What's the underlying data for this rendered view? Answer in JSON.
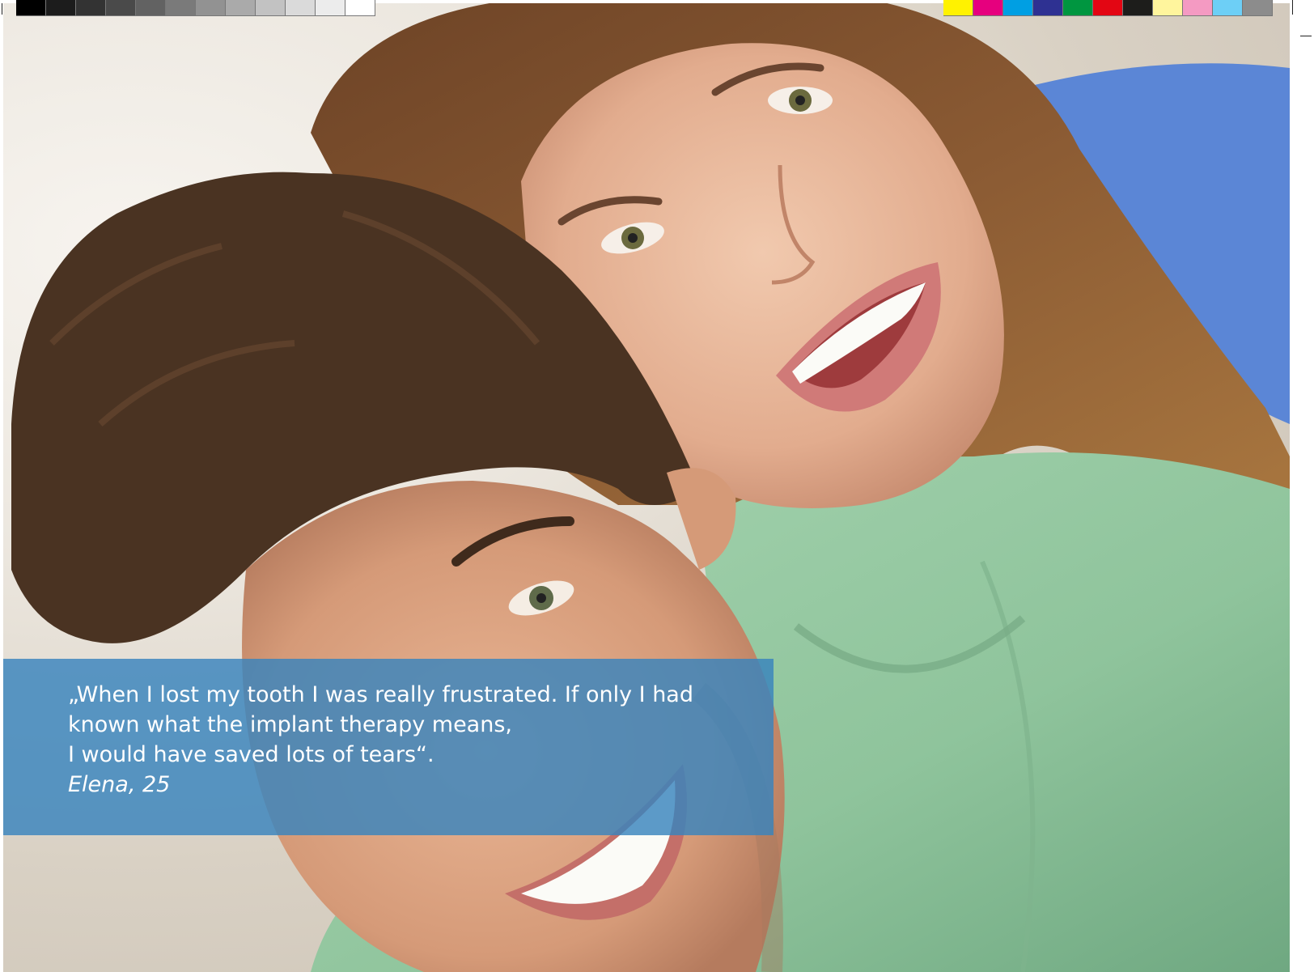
{
  "print_marks": {
    "gray_scale": [
      "#000000",
      "#1c1c1c",
      "#333333",
      "#4a4a4a",
      "#626262",
      "#7a7a7a",
      "#929292",
      "#aaaaaa",
      "#c2c2c2",
      "#dadada",
      "#ececec",
      "#ffffff"
    ],
    "process_colors": [
      "#fff200",
      "#e6007e",
      "#009fe3",
      "#2e3192",
      "#009640",
      "#e30613",
      "#1d1d1b",
      "#fff59d",
      "#f49ac2",
      "#6dcff6",
      "#8c8c8c"
    ]
  },
  "photo": {
    "subject": "smiling young man and woman embracing, heads together",
    "colors": {
      "skin": "#e8b79a",
      "skin_shadow": "#c98e72",
      "hair_man": "#4a3322",
      "hair_woman": "#8a5a33",
      "shirt": "#8fc49c",
      "sleeve_blue": "#5b86d6",
      "teeth": "#fbfbf7",
      "lips": "#d07a78"
    }
  },
  "testimonial": {
    "lines": [
      "„When I lost my tooth I was really frustrated. If only I had",
      "known what the implant therapy means,",
      "I would have saved lots of tears“."
    ],
    "author": "Elena, 25",
    "box_color": "#3884bd"
  }
}
